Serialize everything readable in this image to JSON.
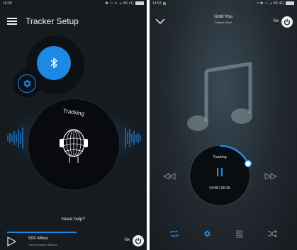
{
  "left": {
    "status": {
      "time": "16:00",
      "right": "✱ ☉ ᯤ ⊿ 89 4G"
    },
    "header": {
      "title": "Tracker Setup",
      "menu_icon": "hamburger-icon"
    },
    "bluetooth": {
      "icon": "bluetooth-icon",
      "color": "#1e88e5"
    },
    "settings": {
      "icon": "gear-icon"
    },
    "tracking": {
      "label": "Tracking",
      "icon": "head-icon"
    },
    "help_link": "Need help?",
    "player": {
      "song": "500 Miles",
      "artist": "The Innocence Mission",
      "nx_label": "Nx",
      "power_icon": "power-icon"
    }
  },
  "right": {
    "status": {
      "time": "14:53",
      "right": "◊ ✱ ☉ ⊿ 88 4G"
    },
    "header": {
      "title": "Until You",
      "subtitle": "Shayne Ward",
      "nx_label": "Nx",
      "collapse_icon": "chevron-down-icon"
    },
    "artwork_icon": "music-note-icon",
    "player": {
      "tracking_label": "Tracking",
      "time": "04:08 | 00:39",
      "pause_icon": "pause-icon"
    },
    "controls": {
      "rewind_icon": "rewind-icon",
      "forward_icon": "fast-forward-icon"
    },
    "bottom_bar": [
      "repeat-icon",
      "gear-icon",
      "playlist-icon",
      "shuffle-icon"
    ]
  },
  "colors": {
    "accent": "#1e88e5",
    "background": "#161b20"
  }
}
